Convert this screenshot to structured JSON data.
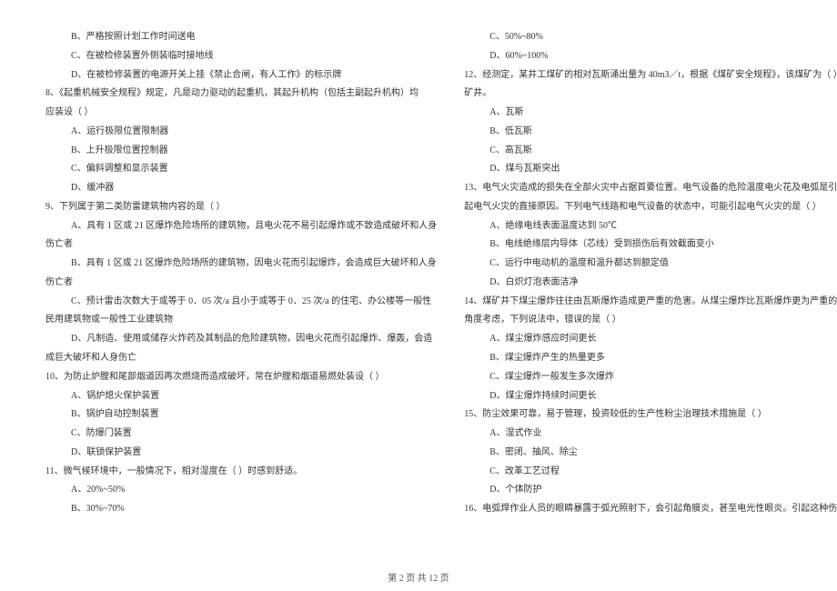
{
  "left": [
    {
      "indent": 1,
      "text": "B、严格按照计划工作时间送电"
    },
    {
      "indent": 1,
      "text": "C、在被检修装置外侧装临时接地线"
    },
    {
      "indent": 1,
      "text": "D、在被检修装置的电源开关上挂《禁止合闸，有人工作》的标示牌"
    },
    {
      "indent": 0,
      "text": "8、《起重机械安全规程》规定，凡是动力驱动的起重机，其起升机构（包括主副起升机构）均"
    },
    {
      "indent": 0,
      "text": "应装设（    ）"
    },
    {
      "indent": 1,
      "text": "A、运行极限位置限制器"
    },
    {
      "indent": 1,
      "text": "B、上升极限位置控制器"
    },
    {
      "indent": 1,
      "text": "C、偏斜调整和显示装置"
    },
    {
      "indent": 1,
      "text": "D、缓冲器"
    },
    {
      "indent": 0,
      "text": "9、下列属于第二类防雷建筑物内容的是（    ）"
    },
    {
      "indent": 1,
      "text": "A、具有 1 区或 21 区爆炸危险场所的建筑物，且电火花不易引起爆炸或不致造成破坏和人身"
    },
    {
      "indent": 0,
      "text": "伤亡者"
    },
    {
      "indent": 1,
      "text": "B、具有 1 区或 21 区爆炸危险场所的建筑物，因电火花而引起爆炸，会造成巨大破坏和人身"
    },
    {
      "indent": 0,
      "text": "伤亡者"
    },
    {
      "indent": 1,
      "text": "C、预计雷击次数大于或等于 0．05 次/a 且小于或等于 0．25 次/a 的住宅、办公楼等一般性"
    },
    {
      "indent": 0,
      "text": "民用建筑物或一般性工业建筑物"
    },
    {
      "indent": 1,
      "text": "D、凡制造、使用或储存火炸药及其制品的危险建筑物，因电火花而引起爆炸、爆轰，会造"
    },
    {
      "indent": 0,
      "text": "成巨大破坏和人身伤亡"
    },
    {
      "indent": 0,
      "text": "10、为防止炉膛和尾部烟道因再次燃烧而造成破坏，常在炉膛和烟道易燃处装设（    ）"
    },
    {
      "indent": 1,
      "text": "A、锅炉熄火保护装置"
    },
    {
      "indent": 1,
      "text": "B、锅炉自动控制装置"
    },
    {
      "indent": 1,
      "text": "C、防爆门装置"
    },
    {
      "indent": 1,
      "text": "D、联锁保护装置"
    },
    {
      "indent": 0,
      "text": "11、微气候环境中，一般情况下，相对湿度在（    ）时感到舒适。"
    },
    {
      "indent": 1,
      "text": "A、20%~50%"
    },
    {
      "indent": 1,
      "text": "B、30%~70%"
    }
  ],
  "right": [
    {
      "indent": 1,
      "text": "C、50%~80%"
    },
    {
      "indent": 1,
      "text": "D、60%~100%"
    },
    {
      "indent": 0,
      "text": "12、经测定，某井工煤矿的相对瓦斯涌出量为 40m3／t，根据《煤矿安全规程》，该煤矿为（    ）"
    },
    {
      "indent": 0,
      "text": "矿井。"
    },
    {
      "indent": 1,
      "text": "A、瓦斯"
    },
    {
      "indent": 1,
      "text": "B、低瓦斯"
    },
    {
      "indent": 1,
      "text": "C、高瓦斯"
    },
    {
      "indent": 1,
      "text": "D、煤与瓦斯突出"
    },
    {
      "indent": 0,
      "text": "13、电气火灾造成的损失在全部火灾中占据首要位置。电气设备的危险温度电火花及电弧是引"
    },
    {
      "indent": 0,
      "text": "起电气火灾的直接原因。下列电气线路和电气设备的状态中，可能引起电气火灾的是（    ）"
    },
    {
      "indent": 1,
      "text": "A、绝缘电线表面温度达到 50℃"
    },
    {
      "indent": 1,
      "text": "B、电线绝缘层内导体（芯线）受到损伤后有效截面变小"
    },
    {
      "indent": 1,
      "text": "C、运行中电动机的温度和温升都达到额定值"
    },
    {
      "indent": 1,
      "text": "D、白炽灯泡表面洁净"
    },
    {
      "indent": 0,
      "text": "14、煤矿井下煤尘爆炸往往由瓦斯爆炸造成更严重的危害。从煤尘爆炸比瓦斯爆炸更为严重的"
    },
    {
      "indent": 0,
      "text": "角度考虑，下列说法中，错误的是（    ）"
    },
    {
      "indent": 1,
      "text": "A、煤尘爆炸感应时间更长"
    },
    {
      "indent": 1,
      "text": "B、煤尘爆炸产生的热量更多"
    },
    {
      "indent": 1,
      "text": "C、煤尘爆炸一般发生多次爆炸"
    },
    {
      "indent": 1,
      "text": "D、煤尘爆炸持续时间更长"
    },
    {
      "indent": 0,
      "text": "15、防尘效果可靠，易于管理，投资较低的生产性粉尘治理技术措施是（    ）"
    },
    {
      "indent": 1,
      "text": "A、湿式作业"
    },
    {
      "indent": 1,
      "text": "B、密闭、抽风、除尘"
    },
    {
      "indent": 1,
      "text": "C、改革工艺过程"
    },
    {
      "indent": 1,
      "text": "D、个体防护"
    },
    {
      "indent": 0,
      "text": "16、电弧焊作业人员的眼睛暴露于弧光照射下，会引起角膜炎，甚至电光性眼炎。引起这种伤"
    }
  ],
  "footer": "第 2 页 共 12 页"
}
